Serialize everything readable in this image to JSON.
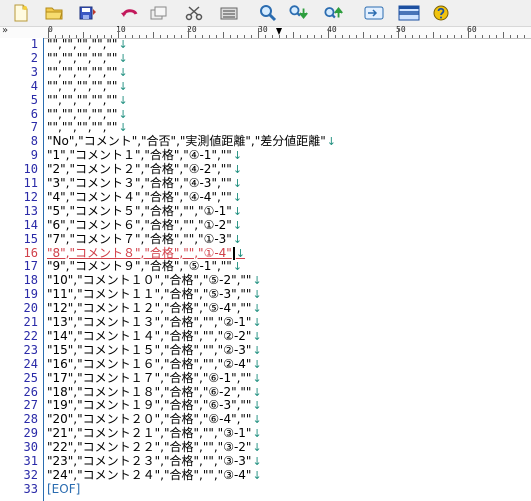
{
  "toolbar": {
    "icons": [
      "new-file-icon",
      "open-folder-icon",
      "save-icon",
      "undo-icon",
      "copy-icon",
      "cut-icon",
      "paste-icon",
      "search-icon",
      "search-next-icon",
      "search-prev-icon",
      "goto-icon",
      "split-icon",
      "help-icon"
    ]
  },
  "ruler": {
    "marker": "»",
    "labels": [
      "0",
      "10",
      "20",
      "30",
      "40",
      "50",
      "60"
    ]
  },
  "editor": {
    "lines": [
      {
        "no": "1",
        "text": "\"\",\"\",\"\",\"\",\"\"",
        "ret": "↓"
      },
      {
        "no": "2",
        "text": "\"\",\"\",\"\",\"\",\"\"",
        "ret": "↓"
      },
      {
        "no": "3",
        "text": "\"\",\"\",\"\",\"\",\"\"",
        "ret": "↓"
      },
      {
        "no": "4",
        "text": "\"\",\"\",\"\",\"\",\"\"",
        "ret": "↓"
      },
      {
        "no": "5",
        "text": "\"\",\"\",\"\",\"\",\"\"",
        "ret": "↓"
      },
      {
        "no": "6",
        "text": "\"\",\"\",\"\",\"\",\"\"",
        "ret": "↓"
      },
      {
        "no": "7",
        "text": "\"\",\"\",\"\",\"\",\"\"",
        "ret": "↓"
      },
      {
        "no": "8",
        "text": "\"No\",\"コメント\",\"合否\",\"実測値距離\",\"差分値距離\"",
        "ret": "↓"
      },
      {
        "no": "9",
        "text": "\"1\",\"コメント１\",\"合格\",\"④-1\",\"\"",
        "ret": "↓"
      },
      {
        "no": "10",
        "text": "\"2\",\"コメント２\",\"合格\",\"④-2\",\"\"",
        "ret": "↓"
      },
      {
        "no": "11",
        "text": "\"3\",\"コメント３\",\"合格\",\"④-3\",\"\"",
        "ret": "↓"
      },
      {
        "no": "12",
        "text": "\"4\",\"コメント４\",\"合格\",\"④-4\",\"\"",
        "ret": "↓"
      },
      {
        "no": "13",
        "text": "\"5\",\"コメント５\",\"合格\",\"\",\"①-1\"",
        "ret": "↓"
      },
      {
        "no": "14",
        "text": "\"6\",\"コメント６\",\"合格\",\"\",\"①-2\"",
        "ret": "↓"
      },
      {
        "no": "15",
        "text": "\"7\",\"コメント７\",\"合格\",\"\",\"①-3\"",
        "ret": "↓"
      },
      {
        "no": "16",
        "text": "\"8\",\"コメント８\",\"合格\",\"\",\"①-4\"",
        "ret": "↓",
        "current": true
      },
      {
        "no": "17",
        "text": "\"9\",\"コメント９\",\"合格\",\"⑤-1\",\"\"",
        "ret": "↓"
      },
      {
        "no": "18",
        "text": "\"10\",\"コメント１０\",\"合格\",\"⑤-2\",\"\"",
        "ret": "↓"
      },
      {
        "no": "19",
        "text": "\"11\",\"コメント１１\",\"合格\",\"⑤-3\",\"\"",
        "ret": "↓"
      },
      {
        "no": "20",
        "text": "\"12\",\"コメント１２\",\"合格\",\"⑤-4\",\"\"",
        "ret": "↓"
      },
      {
        "no": "21",
        "text": "\"13\",\"コメント１３\",\"合格\",\"\",\"②-1\"",
        "ret": "↓"
      },
      {
        "no": "22",
        "text": "\"14\",\"コメント１４\",\"合格\",\"\",\"②-2\"",
        "ret": "↓"
      },
      {
        "no": "23",
        "text": "\"15\",\"コメント１５\",\"合格\",\"\",\"②-3\"",
        "ret": "↓"
      },
      {
        "no": "24",
        "text": "\"16\",\"コメント１６\",\"合格\",\"\",\"②-4\"",
        "ret": "↓"
      },
      {
        "no": "25",
        "text": "\"17\",\"コメント１７\",\"合格\",\"⑥-1\",\"\"",
        "ret": "↓"
      },
      {
        "no": "26",
        "text": "\"18\",\"コメント１８\",\"合格\",\"⑥-2\",\"\"",
        "ret": "↓"
      },
      {
        "no": "27",
        "text": "\"19\",\"コメント１９\",\"合格\",\"⑥-3\",\"\"",
        "ret": "↓"
      },
      {
        "no": "28",
        "text": "\"20\",\"コメント２０\",\"合格\",\"⑥-4\",\"\"",
        "ret": "↓"
      },
      {
        "no": "29",
        "text": "\"21\",\"コメント２１\",\"合格\",\"\",\"③-1\"",
        "ret": "↓"
      },
      {
        "no": "30",
        "text": "\"22\",\"コメント２２\",\"合格\",\"\",\"③-2\"",
        "ret": "↓"
      },
      {
        "no": "31",
        "text": "\"23\",\"コメント２３\",\"合格\",\"\",\"③-3\"",
        "ret": "↓"
      },
      {
        "no": "32",
        "text": "\"24\",\"コメント２４\",\"合格\",\"\",\"③-4\"",
        "ret": "↓"
      },
      {
        "no": "33",
        "text": "",
        "eof": "[EOF]"
      }
    ]
  },
  "colors": {
    "line_number": "#2a2aa8",
    "return_mark": "#1f8f7f",
    "current_line": "#d0404a",
    "eof": "#2a6cb0"
  }
}
